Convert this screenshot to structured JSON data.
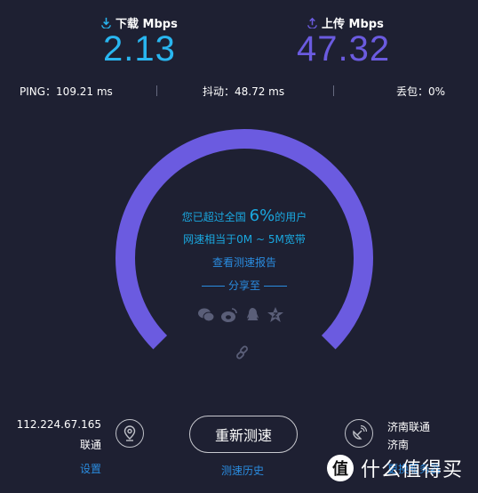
{
  "download": {
    "label": "下载 Mbps",
    "value": "2.13",
    "color": "#29b6f0"
  },
  "upload": {
    "label": "上传 Mbps",
    "value": "47.32",
    "color": "#6b5be0"
  },
  "stats": {
    "ping": "PING：109.21 ms",
    "jitter": "抖动：48.72 ms",
    "loss": "丢包：0%"
  },
  "gauge": {
    "color": "#6b5be0",
    "percentile": "6%"
  },
  "center": {
    "line1_prefix": "您已超过全国",
    "line1_pct": "6%",
    "line1_suffix": "的用户",
    "line2": "网速相当于0M ~ 5M宽带",
    "report_link": "查看测速报告",
    "share_label": "分享至",
    "share_icons": [
      "wechat-icon",
      "weibo-icon",
      "qq-icon",
      "qzone-icon"
    ]
  },
  "client": {
    "ip": "112.224.67.165",
    "isp": "联通",
    "settings": "设置"
  },
  "retest_button": "重新测速",
  "history_link": "测速历史",
  "server": {
    "name": "济南联通",
    "city": "济南",
    "change": "更换服务器"
  },
  "watermark": {
    "badge": "值",
    "text": "什么值得买"
  }
}
